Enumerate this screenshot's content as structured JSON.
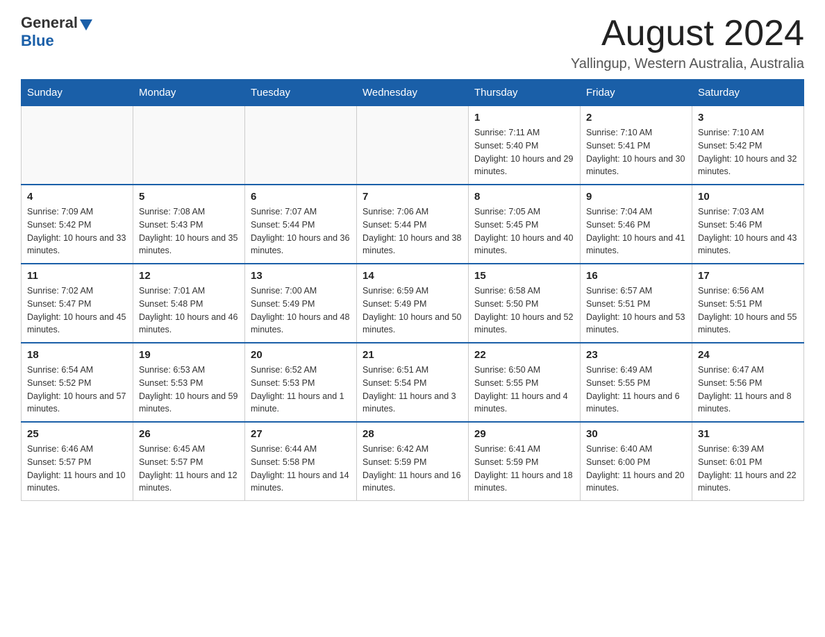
{
  "header": {
    "logo_general": "General",
    "logo_blue": "Blue",
    "month_title": "August 2024",
    "location": "Yallingup, Western Australia, Australia"
  },
  "calendar": {
    "days_of_week": [
      "Sunday",
      "Monday",
      "Tuesday",
      "Wednesday",
      "Thursday",
      "Friday",
      "Saturday"
    ],
    "weeks": [
      [
        {
          "day": "",
          "info": ""
        },
        {
          "day": "",
          "info": ""
        },
        {
          "day": "",
          "info": ""
        },
        {
          "day": "",
          "info": ""
        },
        {
          "day": "1",
          "info": "Sunrise: 7:11 AM\nSunset: 5:40 PM\nDaylight: 10 hours and 29 minutes."
        },
        {
          "day": "2",
          "info": "Sunrise: 7:10 AM\nSunset: 5:41 PM\nDaylight: 10 hours and 30 minutes."
        },
        {
          "day": "3",
          "info": "Sunrise: 7:10 AM\nSunset: 5:42 PM\nDaylight: 10 hours and 32 minutes."
        }
      ],
      [
        {
          "day": "4",
          "info": "Sunrise: 7:09 AM\nSunset: 5:42 PM\nDaylight: 10 hours and 33 minutes."
        },
        {
          "day": "5",
          "info": "Sunrise: 7:08 AM\nSunset: 5:43 PM\nDaylight: 10 hours and 35 minutes."
        },
        {
          "day": "6",
          "info": "Sunrise: 7:07 AM\nSunset: 5:44 PM\nDaylight: 10 hours and 36 minutes."
        },
        {
          "day": "7",
          "info": "Sunrise: 7:06 AM\nSunset: 5:44 PM\nDaylight: 10 hours and 38 minutes."
        },
        {
          "day": "8",
          "info": "Sunrise: 7:05 AM\nSunset: 5:45 PM\nDaylight: 10 hours and 40 minutes."
        },
        {
          "day": "9",
          "info": "Sunrise: 7:04 AM\nSunset: 5:46 PM\nDaylight: 10 hours and 41 minutes."
        },
        {
          "day": "10",
          "info": "Sunrise: 7:03 AM\nSunset: 5:46 PM\nDaylight: 10 hours and 43 minutes."
        }
      ],
      [
        {
          "day": "11",
          "info": "Sunrise: 7:02 AM\nSunset: 5:47 PM\nDaylight: 10 hours and 45 minutes."
        },
        {
          "day": "12",
          "info": "Sunrise: 7:01 AM\nSunset: 5:48 PM\nDaylight: 10 hours and 46 minutes."
        },
        {
          "day": "13",
          "info": "Sunrise: 7:00 AM\nSunset: 5:49 PM\nDaylight: 10 hours and 48 minutes."
        },
        {
          "day": "14",
          "info": "Sunrise: 6:59 AM\nSunset: 5:49 PM\nDaylight: 10 hours and 50 minutes."
        },
        {
          "day": "15",
          "info": "Sunrise: 6:58 AM\nSunset: 5:50 PM\nDaylight: 10 hours and 52 minutes."
        },
        {
          "day": "16",
          "info": "Sunrise: 6:57 AM\nSunset: 5:51 PM\nDaylight: 10 hours and 53 minutes."
        },
        {
          "day": "17",
          "info": "Sunrise: 6:56 AM\nSunset: 5:51 PM\nDaylight: 10 hours and 55 minutes."
        }
      ],
      [
        {
          "day": "18",
          "info": "Sunrise: 6:54 AM\nSunset: 5:52 PM\nDaylight: 10 hours and 57 minutes."
        },
        {
          "day": "19",
          "info": "Sunrise: 6:53 AM\nSunset: 5:53 PM\nDaylight: 10 hours and 59 minutes."
        },
        {
          "day": "20",
          "info": "Sunrise: 6:52 AM\nSunset: 5:53 PM\nDaylight: 11 hours and 1 minute."
        },
        {
          "day": "21",
          "info": "Sunrise: 6:51 AM\nSunset: 5:54 PM\nDaylight: 11 hours and 3 minutes."
        },
        {
          "day": "22",
          "info": "Sunrise: 6:50 AM\nSunset: 5:55 PM\nDaylight: 11 hours and 4 minutes."
        },
        {
          "day": "23",
          "info": "Sunrise: 6:49 AM\nSunset: 5:55 PM\nDaylight: 11 hours and 6 minutes."
        },
        {
          "day": "24",
          "info": "Sunrise: 6:47 AM\nSunset: 5:56 PM\nDaylight: 11 hours and 8 minutes."
        }
      ],
      [
        {
          "day": "25",
          "info": "Sunrise: 6:46 AM\nSunset: 5:57 PM\nDaylight: 11 hours and 10 minutes."
        },
        {
          "day": "26",
          "info": "Sunrise: 6:45 AM\nSunset: 5:57 PM\nDaylight: 11 hours and 12 minutes."
        },
        {
          "day": "27",
          "info": "Sunrise: 6:44 AM\nSunset: 5:58 PM\nDaylight: 11 hours and 14 minutes."
        },
        {
          "day": "28",
          "info": "Sunrise: 6:42 AM\nSunset: 5:59 PM\nDaylight: 11 hours and 16 minutes."
        },
        {
          "day": "29",
          "info": "Sunrise: 6:41 AM\nSunset: 5:59 PM\nDaylight: 11 hours and 18 minutes."
        },
        {
          "day": "30",
          "info": "Sunrise: 6:40 AM\nSunset: 6:00 PM\nDaylight: 11 hours and 20 minutes."
        },
        {
          "day": "31",
          "info": "Sunrise: 6:39 AM\nSunset: 6:01 PM\nDaylight: 11 hours and 22 minutes."
        }
      ]
    ]
  }
}
